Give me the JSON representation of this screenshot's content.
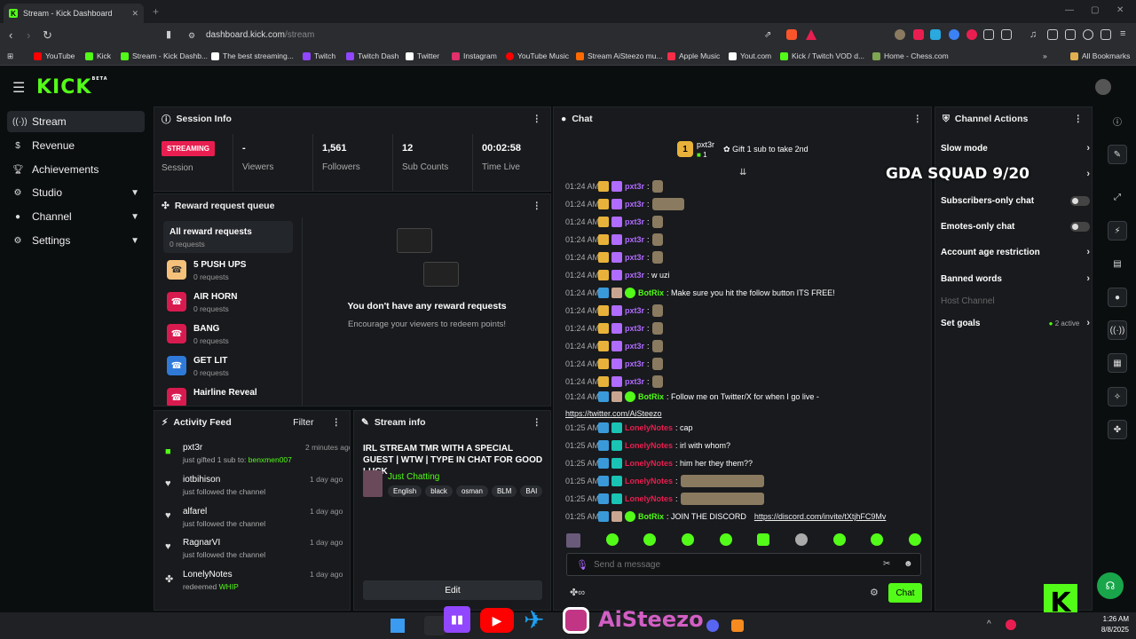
{
  "browser": {
    "tab_title": "Stream - Kick Dashboard",
    "url_domain": "dashboard.kick.com",
    "url_path": "/stream",
    "bookmarks": [
      {
        "label": "YouTube",
        "color": "#ff0000"
      },
      {
        "label": "Kick",
        "color": "#53fc18"
      },
      {
        "label": "Stream - Kick Dashb...",
        "color": "#53fc18"
      },
      {
        "label": "The best streaming...",
        "color": "#ffffff"
      },
      {
        "label": "Twitch",
        "color": "#9146ff"
      },
      {
        "label": "Twitch Dash",
        "color": "#9146ff"
      },
      {
        "label": "Twitter",
        "color": "#ffffff"
      },
      {
        "label": "Instagram",
        "color": "#e1306c"
      },
      {
        "label": "YouTube Music",
        "color": "#ff0000"
      },
      {
        "label": "Stream AiSteezo mu...",
        "color": "#ff6a00"
      },
      {
        "label": "Apple Music",
        "color": "#fa2d48"
      },
      {
        "label": "Yout.com",
        "color": "#ffffff"
      },
      {
        "label": "Kick / Twitch VOD d...",
        "color": "#53fc18"
      },
      {
        "label": "Home - Chess.com",
        "color": "#7fa650"
      }
    ],
    "all_bookmarks": "All Bookmarks"
  },
  "app": {
    "logo": "KICK",
    "logo_sup": "BETA",
    "accent": "#53fc18"
  },
  "sidebar": {
    "items": [
      {
        "label": "Stream",
        "icon": "stream-icon"
      },
      {
        "label": "Revenue",
        "icon": "dollar-icon"
      },
      {
        "label": "Achievements",
        "icon": "trophy-icon"
      },
      {
        "label": "Studio",
        "icon": "gear-icon"
      },
      {
        "label": "Channel",
        "icon": "person-icon"
      },
      {
        "label": "Settings",
        "icon": "gear-icon"
      }
    ]
  },
  "session": {
    "title": "Session Info",
    "badge": "STREAMING",
    "session_label": "Session",
    "stats": [
      {
        "value": "-",
        "label": "Viewers"
      },
      {
        "value": "1,561",
        "label": "Followers"
      },
      {
        "value": "12",
        "label": "Sub Counts"
      },
      {
        "value": "00:02:58",
        "label": "Time Live"
      }
    ]
  },
  "rewards": {
    "title": "Reward request queue",
    "all_label": "All reward requests",
    "all_count": "0 requests",
    "items": [
      {
        "name": "5 PUSH UPS",
        "count": "0 requests",
        "color": "#f5c17a"
      },
      {
        "name": "AIR HORN",
        "count": "0 requests",
        "color": "#d81b4f"
      },
      {
        "name": "BANG",
        "count": "0 requests",
        "color": "#d81b4f"
      },
      {
        "name": "GET LIT",
        "count": "0 requests",
        "color": "#2f7ad8"
      },
      {
        "name": "Hairline Reveal",
        "count": "",
        "color": "#d81b4f"
      }
    ],
    "empty_title": "You don't have any reward requests",
    "empty_sub": "Encourage your viewers to redeem points!"
  },
  "activity": {
    "title": "Activity Feed",
    "filter": "Filter",
    "items": [
      {
        "name": "pxt3r",
        "desc": "just gifted 1 sub to:",
        "target": "benxmen007",
        "time": "2 minutes ago",
        "icon": "gift-icon"
      },
      {
        "name": "iotbihison",
        "desc": "just followed the channel",
        "target": "",
        "time": "1 day ago",
        "icon": "heart-icon"
      },
      {
        "name": "alfarel",
        "desc": "just followed the channel",
        "target": "",
        "time": "1 day ago",
        "icon": "heart-icon"
      },
      {
        "name": "RagnarVI",
        "desc": "just followed the channel",
        "target": "",
        "time": "1 day ago",
        "icon": "heart-icon"
      },
      {
        "name": "LonelyNotes",
        "desc": "redeemed",
        "target": "WHIP",
        "time": "1 day ago",
        "icon": "redeem-icon"
      }
    ]
  },
  "stream_info": {
    "title": "Stream info",
    "stream_title": "IRL STREAM TMR WITH A SPECIAL GUEST | WTW | TYPE IN CHAT FOR GOOD LUCK",
    "category": "Just Chatting",
    "tags": [
      "English",
      "black",
      "osman",
      "BLM",
      "BAI"
    ],
    "edit": "Edit"
  },
  "chat": {
    "title": "Chat",
    "pinned_user": "pxt3r",
    "pinned_count": "1",
    "pinned_text": "Gift 1 sub to take 2nd",
    "overlay": "GDA SQUAD 9/20",
    "messages": [
      {
        "time": "01:24 AM",
        "user": "pxt3r",
        "color": "#b06bff",
        "text": ":",
        "emote": 12
      },
      {
        "time": "01:24 AM",
        "user": "pxt3r",
        "color": "#b06bff",
        "text": ":",
        "emote": 36
      },
      {
        "time": "01:24 AM",
        "user": "pxt3r",
        "color": "#b06bff",
        "text": ":",
        "emote": 12
      },
      {
        "time": "01:24 AM",
        "user": "pxt3r",
        "color": "#b06bff",
        "text": ":",
        "emote": 12
      },
      {
        "time": "01:24 AM",
        "user": "pxt3r",
        "color": "#b06bff",
        "text": ":",
        "emote": 12
      },
      {
        "time": "01:24 AM",
        "user": "pxt3r",
        "color": "#b06bff",
        "text": ": w uzi",
        "emote": 0
      },
      {
        "time": "01:24 AM",
        "user": "BotRix",
        "color": "#53fc18",
        "text": ": Make sure you hit the follow button ITS FREE!",
        "emote": 0
      },
      {
        "time": "01:24 AM",
        "user": "pxt3r",
        "color": "#b06bff",
        "text": ":",
        "emote": 12
      },
      {
        "time": "01:24 AM",
        "user": "pxt3r",
        "color": "#b06bff",
        "text": ":",
        "emote": 12
      },
      {
        "time": "01:24 AM",
        "user": "pxt3r",
        "color": "#b06bff",
        "text": ":",
        "emote": 12
      },
      {
        "time": "01:24 AM",
        "user": "pxt3r",
        "color": "#b06bff",
        "text": ":",
        "emote": 12
      },
      {
        "time": "01:24 AM",
        "user": "pxt3r",
        "color": "#b06bff",
        "text": ":",
        "emote": 12
      },
      {
        "time": "01:24 AM",
        "user": "BotRix",
        "color": "#53fc18",
        "text": ": Follow me on Twitter/X for when I go live -",
        "emote": 0,
        "link": "https://twitter.com/AiSteezo"
      },
      {
        "time": "01:25 AM",
        "user": "LonelyNotes",
        "color": "#e91e50",
        "text": ": cap",
        "emote": 0
      },
      {
        "time": "01:25 AM",
        "user": "LonelyNotes",
        "color": "#e91e50",
        "text": ": irl with whom?",
        "emote": 0
      },
      {
        "time": "01:25 AM",
        "user": "LonelyNotes",
        "color": "#e91e50",
        "text": ": him her they them??",
        "emote": 0
      },
      {
        "time": "01:25 AM",
        "user": "LonelyNotes",
        "color": "#e91e50",
        "text": ":",
        "emote": 94
      },
      {
        "time": "01:25 AM",
        "user": "LonelyNotes",
        "color": "#e91e50",
        "text": ":",
        "emote": 94
      },
      {
        "time": "01:25 AM",
        "user": "BotRix",
        "color": "#53fc18",
        "text": ": JOIN THE DISCORD",
        "emote": 0,
        "link": "https://discord.com/invite/tXtjhFC9Mv"
      }
    ],
    "input_placeholder": "Send a message",
    "send": "Chat"
  },
  "channel_actions": {
    "title": "Channel Actions",
    "items": [
      {
        "label": "Slow mode",
        "kind": "chevron"
      },
      {
        "label": "",
        "kind": "chevron"
      },
      {
        "label": "Subscribers-only chat",
        "kind": "toggle"
      },
      {
        "label": "Emotes-only chat",
        "kind": "toggle"
      },
      {
        "label": "Account age restriction",
        "kind": "chevron"
      },
      {
        "label": "Banned words",
        "kind": "chevron"
      },
      {
        "label": "Host Channel",
        "kind": "disabled"
      },
      {
        "label": "Set goals",
        "kind": "goals"
      }
    ],
    "goals_active": "2 active"
  },
  "taskbar": {
    "overlay_name": "AiSteezo",
    "time": "1:26 AM",
    "date": "8/8/2025"
  }
}
